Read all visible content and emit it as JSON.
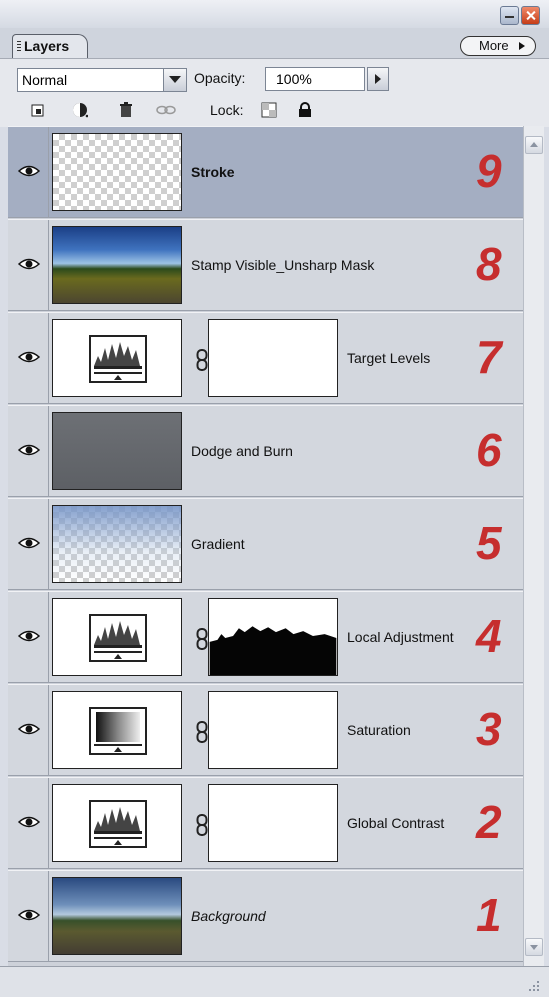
{
  "panel": {
    "tab_label": "Layers",
    "more_label": "More"
  },
  "toolbar": {
    "blend_mode": "Normal",
    "opacity_label": "Opacity:",
    "opacity_value": "100%",
    "lock_label": "Lock:"
  },
  "layers": [
    {
      "name": "Stroke",
      "number": "9",
      "selected": true,
      "thumb": "transparent",
      "mask": false
    },
    {
      "name": "Stamp Visible_Unsharp Mask",
      "number": "8",
      "selected": false,
      "thumb": "photo",
      "mask": false
    },
    {
      "name": "Target Levels",
      "number": "7",
      "selected": false,
      "thumb": "levels",
      "mask": "white"
    },
    {
      "name": "Dodge and Burn",
      "number": "6",
      "selected": false,
      "thumb": "grey",
      "mask": false
    },
    {
      "name": "Gradient",
      "number": "5",
      "selected": false,
      "thumb": "gradient",
      "mask": false
    },
    {
      "name": "Local Adjustment",
      "number": "4",
      "selected": false,
      "thumb": "levels",
      "mask": "silhouette"
    },
    {
      "name": "Saturation",
      "number": "3",
      "selected": false,
      "thumb": "saturation",
      "mask": "white"
    },
    {
      "name": "Global Contrast",
      "number": "2",
      "selected": false,
      "thumb": "levels",
      "mask": "white"
    },
    {
      "name": "Background",
      "number": "1",
      "selected": false,
      "thumb": "photo2",
      "mask": false
    }
  ],
  "colors": {
    "selected_row": "#a4aec2",
    "number_red": "#c62e2e"
  }
}
